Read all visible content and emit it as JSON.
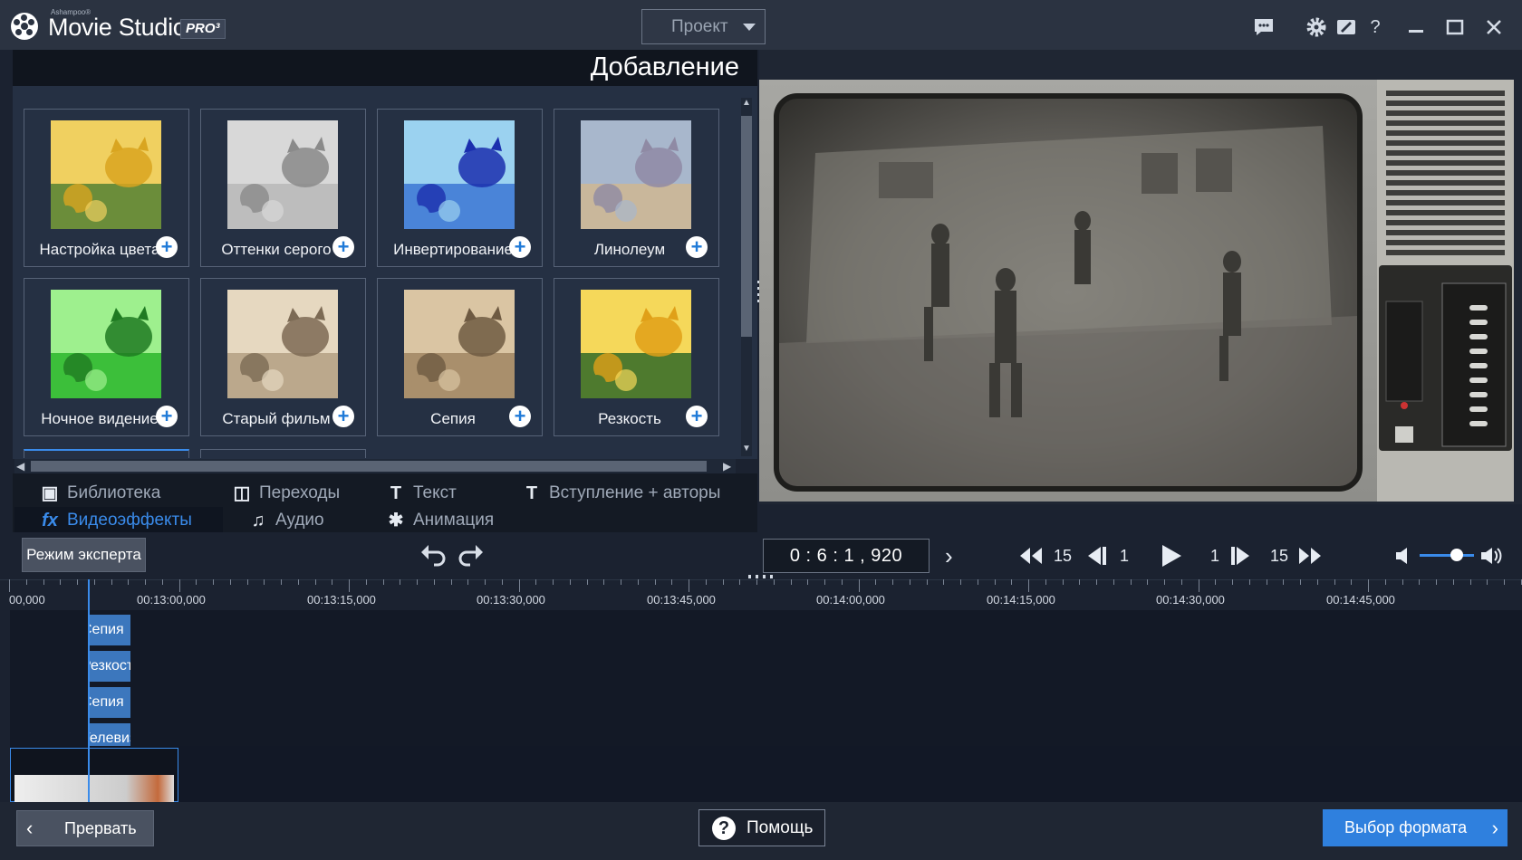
{
  "titlebar": {
    "brand_small": "Ashampoo®",
    "app_title": "Movie Studio",
    "pro_badge": "PRO³",
    "project_dropdown": "Проект",
    "icons": [
      "feedback-icon",
      "settings-icon",
      "skin-icon",
      "help-icon",
      "minimize-icon",
      "maximize-icon",
      "close-icon"
    ]
  },
  "left_panel": {
    "title": "Добавление",
    "effects": [
      {
        "label": "Настройка цвета",
        "thumb_colors": [
          "#d9a520",
          "#6b8d3a",
          "#f0d060"
        ]
      },
      {
        "label": "Оттенки серого",
        "thumb_colors": [
          "#8a8a8a",
          "#bdbdbd",
          "#d8d8d8"
        ]
      },
      {
        "label": "Инвертирование",
        "thumb_colors": [
          "#1b2fae",
          "#4a84d8",
          "#9bd2f0"
        ]
      },
      {
        "label": "Линолеум",
        "thumb_colors": [
          "#8f8aa4",
          "#c9b79b",
          "#a8b7cc"
        ]
      },
      {
        "label": "Ночное видение",
        "thumb_colors": [
          "#1f7a22",
          "#3cbf3a",
          "#9ef08e"
        ]
      },
      {
        "label": "Старый фильм",
        "thumb_colors": [
          "#7c6a54",
          "#bba88c",
          "#e6d8c0"
        ]
      },
      {
        "label": "Сепия",
        "thumb_colors": [
          "#6e5a42",
          "#a98f6c",
          "#dac5a3"
        ]
      },
      {
        "label": "Резкость",
        "thumb_colors": [
          "#e0a018",
          "#4e7a2e",
          "#f5d85a"
        ]
      }
    ]
  },
  "tabs": [
    {
      "label": "Библиотека",
      "icon": "camera-icon",
      "glyph": "▣",
      "active": false
    },
    {
      "label": "Переходы",
      "icon": "transitions-icon",
      "glyph": "◫",
      "active": false
    },
    {
      "label": "Текст",
      "icon": "text-icon",
      "glyph": "T",
      "active": false
    },
    {
      "label": "Вступление + авторы",
      "icon": "credits-icon",
      "glyph": "T",
      "active": false
    },
    {
      "label": "Видеоэффекты",
      "icon": "fx-icon",
      "glyph": "fx",
      "active": true
    },
    {
      "label": "Аудио",
      "icon": "music-note-icon",
      "glyph": "♫",
      "active": false
    },
    {
      "label": "Анимация",
      "icon": "animation-icon",
      "glyph": "✱",
      "active": false
    }
  ],
  "toolbar": {
    "expert_mode": "Режим эксперта",
    "timecode": "0 : 6 : 1 , 920",
    "skip_back_count": "15",
    "frame_back_count": "1",
    "frame_fwd_count": "1",
    "skip_fwd_count": "15",
    "volume_level": 0.7
  },
  "timeline": {
    "ruler_labels": [
      "00,000",
      "00:13:00,000",
      "00:13:15,000",
      "00:13:30,000",
      "00:13:45,000",
      "00:14:00,000",
      "00:14:15,000",
      "00:14:30,000",
      "00:14:45,000"
    ],
    "effect_clips": [
      "Сепия",
      "Резкость",
      "Сепия",
      "Телевизор"
    ]
  },
  "bottombar": {
    "cancel": "Прервать",
    "help": "Помощь",
    "format": "Выбор формата"
  },
  "colors": {
    "accent": "#3a8bea",
    "button_blue": "#2f80de"
  }
}
